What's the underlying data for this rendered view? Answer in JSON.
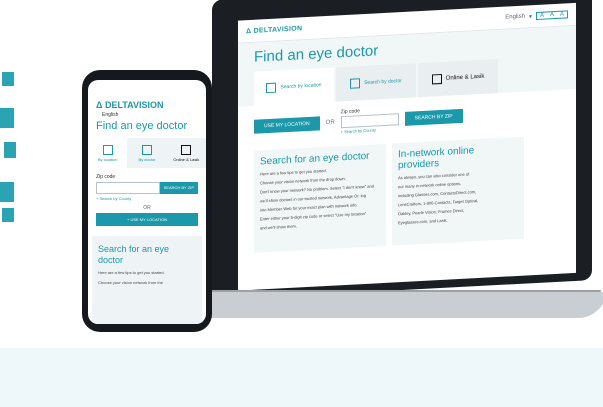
{
  "laptop": {
    "brand": "Δ DELTAVISION",
    "language": "English",
    "size_buttons": [
      "A",
      "A",
      "A"
    ],
    "title": "Find an eye doctor",
    "tabs": [
      {
        "label": "Search by location",
        "icon": "location-pin-icon"
      },
      {
        "label": "Search by doctor",
        "icon": "person-icon"
      },
      {
        "label": "Online & Lasik",
        "icon": "computer-icon"
      }
    ],
    "use_location_label": "USE MY LOCATION",
    "or_label": "OR",
    "zip_label": "Zip code",
    "search_zip_label": "SEARCH BY ZIP",
    "county_link": "+ Search by County",
    "left_panel": {
      "title": "Search for an eye doctor",
      "lines": [
        "Here are a few tips to get you started.",
        "Choose your vision network from the drop down.",
        "Don't know your network? No problem. Select \"I don't know\" and",
        "we'll show doctors in our trusted network, Advantage Or. log",
        "into Member Web for your exact plan with network info.",
        "Enter either your 5-digit zip code or select \"Use my location\"",
        "and we'll show them."
      ]
    },
    "right_panel": {
      "title": "In-network online providers",
      "lines": [
        "As always, you can also consider one of",
        "our many in-network online options,",
        "including Glasses.com, ContactsDirect.com,",
        "LensCrafters, 1-800-Contacts, Target Optical,",
        "Oakley, Pearle Vision, Frames Direct,",
        "Eyeglasses.com, and Lasik."
      ]
    }
  },
  "phone": {
    "brand": "Δ DELTAVISION",
    "language": "English",
    "title": "Find an eye doctor",
    "tabs": [
      {
        "label": "By location",
        "icon": "location-pin-icon"
      },
      {
        "label": "By doctor",
        "icon": "person-icon"
      },
      {
        "label": "Online & Lasik",
        "icon": "computer-icon"
      }
    ],
    "zip_label": "Zip code",
    "search_zip_label": "SEARCH BY ZIP",
    "county_link": "+ Search by County",
    "or_label": "OR",
    "use_location_label": "+ USE MY LOCATION",
    "panel_title": "Search for an eye doctor",
    "panel_text": "Here are a few tips to get you started.",
    "panel_bullet": "Choose your vision network from the"
  },
  "colors": {
    "accent": "#1b98aa",
    "dark": "#15181c"
  }
}
